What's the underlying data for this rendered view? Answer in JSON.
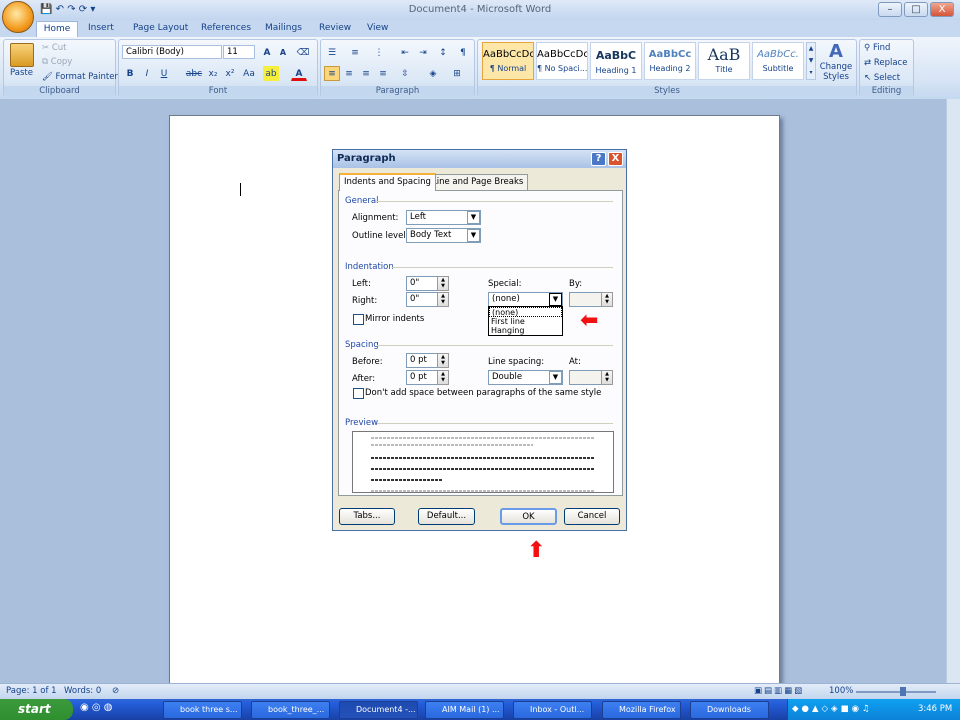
{
  "window": {
    "title": "Document4 - Microsoft Word",
    "minimize": "–",
    "maximize": "□",
    "close": "X",
    "quick_access": "▾"
  },
  "ribbon_tabs": [
    "Home",
    "Insert",
    "Page Layout",
    "References",
    "Mailings",
    "Review",
    "View"
  ],
  "clipboard": {
    "paste": "Paste",
    "cut": "Cut",
    "copy": "Copy",
    "format_painter": "Format Painter",
    "label": "Clipboard"
  },
  "font": {
    "name": "Calibri (Body)",
    "size": "11",
    "label": "Font"
  },
  "paragraph": {
    "label": "Paragraph"
  },
  "styles": {
    "label": "Styles",
    "items": [
      {
        "preview": "AaBbCcDc",
        "name": "¶ Normal"
      },
      {
        "preview": "AaBbCcDc",
        "name": "¶ No Spaci..."
      },
      {
        "preview": "AaBbC",
        "name": "Heading 1"
      },
      {
        "preview": "AaBbCc",
        "name": "Heading 2"
      },
      {
        "preview": "AaB",
        "name": "Title"
      },
      {
        "preview": "AaBbCc.",
        "name": "Subtitle"
      }
    ],
    "change_styles": "Change Styles"
  },
  "editing": {
    "find": "Find",
    "replace": "Replace",
    "select": "Select",
    "label": "Editing"
  },
  "dialog": {
    "title": "Paragraph",
    "help": "?",
    "close": "X",
    "tabs": [
      "Indents and Spacing",
      "Line and Page Breaks"
    ],
    "general": {
      "heading": "General",
      "alignment_label": "Alignment:",
      "alignment": "Left",
      "outline_label": "Outline level:",
      "outline": "Body Text"
    },
    "indentation": {
      "heading": "Indentation",
      "left_label": "Left:",
      "left": "0\"",
      "right_label": "Right:",
      "right": "0\"",
      "special_label": "Special:",
      "special": "(none)",
      "by_label": "By:",
      "mirror": "Mirror indents"
    },
    "special_options": [
      "(none)",
      "First line",
      "Hanging"
    ],
    "spacing": {
      "heading": "Spacing",
      "before_label": "Before:",
      "before": "0 pt",
      "after_label": "After:",
      "after": "0 pt",
      "line_label": "Line spacing:",
      "line": "Double",
      "at_label": "At:",
      "dont_add": "Don't add space between paragraphs of the same style"
    },
    "preview_heading": "Preview",
    "buttons": {
      "tabs": "Tabs...",
      "default": "Default...",
      "ok": "OK",
      "cancel": "Cancel"
    }
  },
  "status": {
    "page": "Page: 1 of 1",
    "words": "Words: 0",
    "zoom": "100%"
  },
  "taskbar": {
    "start": "start",
    "tasks": [
      "book three s...",
      "book_three_...",
      "Document4 -...",
      "AIM Mail (1) ...",
      "Inbox - Outl...",
      "Mozilla Firefox",
      "Downloads"
    ],
    "time": "3:46 PM"
  }
}
